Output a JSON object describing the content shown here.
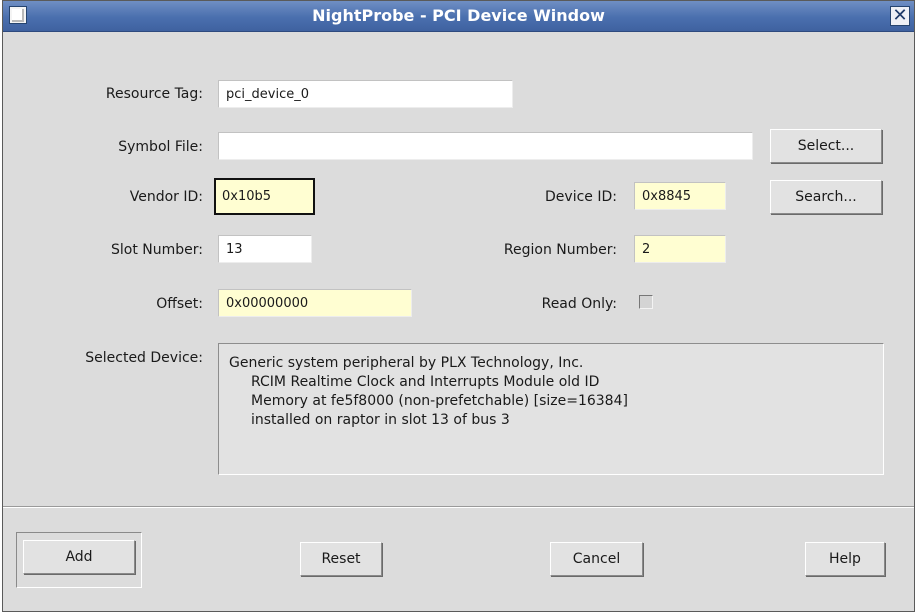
{
  "window": {
    "title": "NightProbe - PCI Device Window"
  },
  "form": {
    "resource_tag": {
      "label": "Resource Tag:",
      "value": "pci_device_0"
    },
    "symbol_file": {
      "label": "Symbol File:",
      "value": ""
    },
    "vendor_id": {
      "label": "Vendor ID:",
      "value": "0x10b5"
    },
    "device_id": {
      "label": "Device ID:",
      "value": "0x8845"
    },
    "slot_number": {
      "label": "Slot Number:",
      "value": "13"
    },
    "region_number": {
      "label": "Region Number:",
      "value": "2"
    },
    "offset": {
      "label": "Offset:",
      "value": "0x00000000"
    },
    "read_only": {
      "label": "Read Only:",
      "checked": false
    }
  },
  "buttons": {
    "select": "Select...",
    "search": "Search...",
    "add": "Add",
    "reset": "Reset",
    "cancel": "Cancel",
    "help": "Help"
  },
  "selected_device": {
    "label": "Selected Device:",
    "lines": [
      "Generic system peripheral by PLX Technology, Inc.",
      "RCIM Realtime Clock and Interrupts Module old ID",
      "Memory at fe5f8000 (non-prefetchable) [size=16384]",
      "installed on raptor in slot 13 of bus 3"
    ]
  },
  "icons": {
    "window_menu": "window-menu-icon",
    "close": "close-icon"
  },
  "colors": {
    "titlebar": "#4a6fae",
    "window_bg": "#dcdcdc",
    "editable_field": "#fffed2",
    "field": "#ffffff"
  }
}
